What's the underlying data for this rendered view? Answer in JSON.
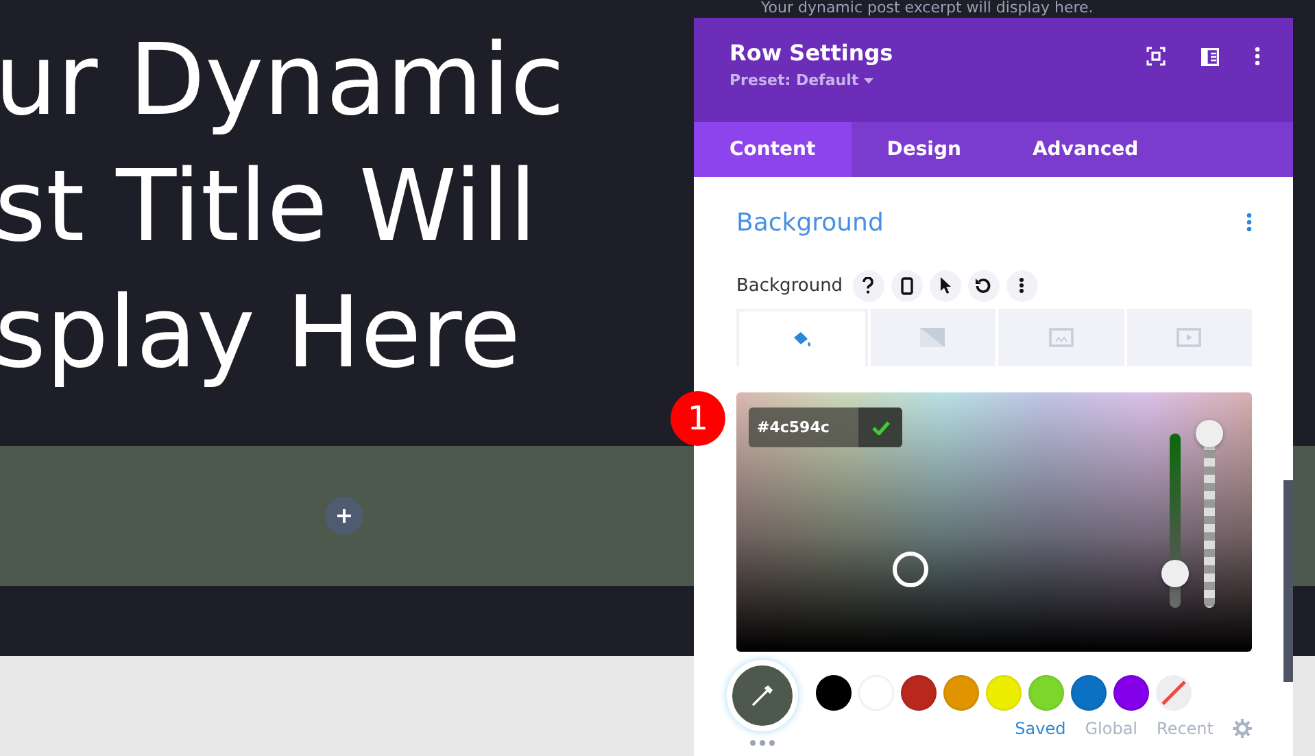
{
  "page": {
    "excerpt": "Your dynamic post excerpt will display here.",
    "title_lines": [
      "ur Dynamic",
      "st Title Will",
      "splay Here"
    ]
  },
  "badge": "1",
  "panel": {
    "title": "Row Settings",
    "preset": "Preset: Default",
    "tabs": [
      {
        "label": "Content",
        "selected": true
      },
      {
        "label": "Design",
        "selected": false
      },
      {
        "label": "Advanced",
        "selected": false
      }
    ]
  },
  "section": {
    "title": "Background",
    "field_label": "Background"
  },
  "bg_types": [
    {
      "kind": "color",
      "selected": true
    },
    {
      "kind": "gradient",
      "selected": false
    },
    {
      "kind": "image",
      "selected": false
    },
    {
      "kind": "video",
      "selected": false
    }
  ],
  "picker": {
    "hex": "#4c594c",
    "hue": {
      "level": 0.2
    },
    "alpha": {
      "level": 1
    }
  },
  "swatches": [
    {
      "kind": "color",
      "color": "#000000"
    },
    {
      "kind": "color",
      "color": "#ffffff"
    },
    {
      "kind": "color",
      "color": "#b8281d"
    },
    {
      "kind": "color",
      "color": "#e09400"
    },
    {
      "kind": "color",
      "color": "#eded00"
    },
    {
      "kind": "color",
      "color": "#7cd62c"
    },
    {
      "kind": "color",
      "color": "#0c71c3"
    },
    {
      "kind": "color",
      "color": "#8300e9"
    },
    {
      "kind": "clear"
    }
  ],
  "palette_tabs": [
    {
      "label": "Saved",
      "selected": true
    },
    {
      "label": "Global",
      "selected": false
    },
    {
      "label": "Recent",
      "selected": false
    }
  ]
}
